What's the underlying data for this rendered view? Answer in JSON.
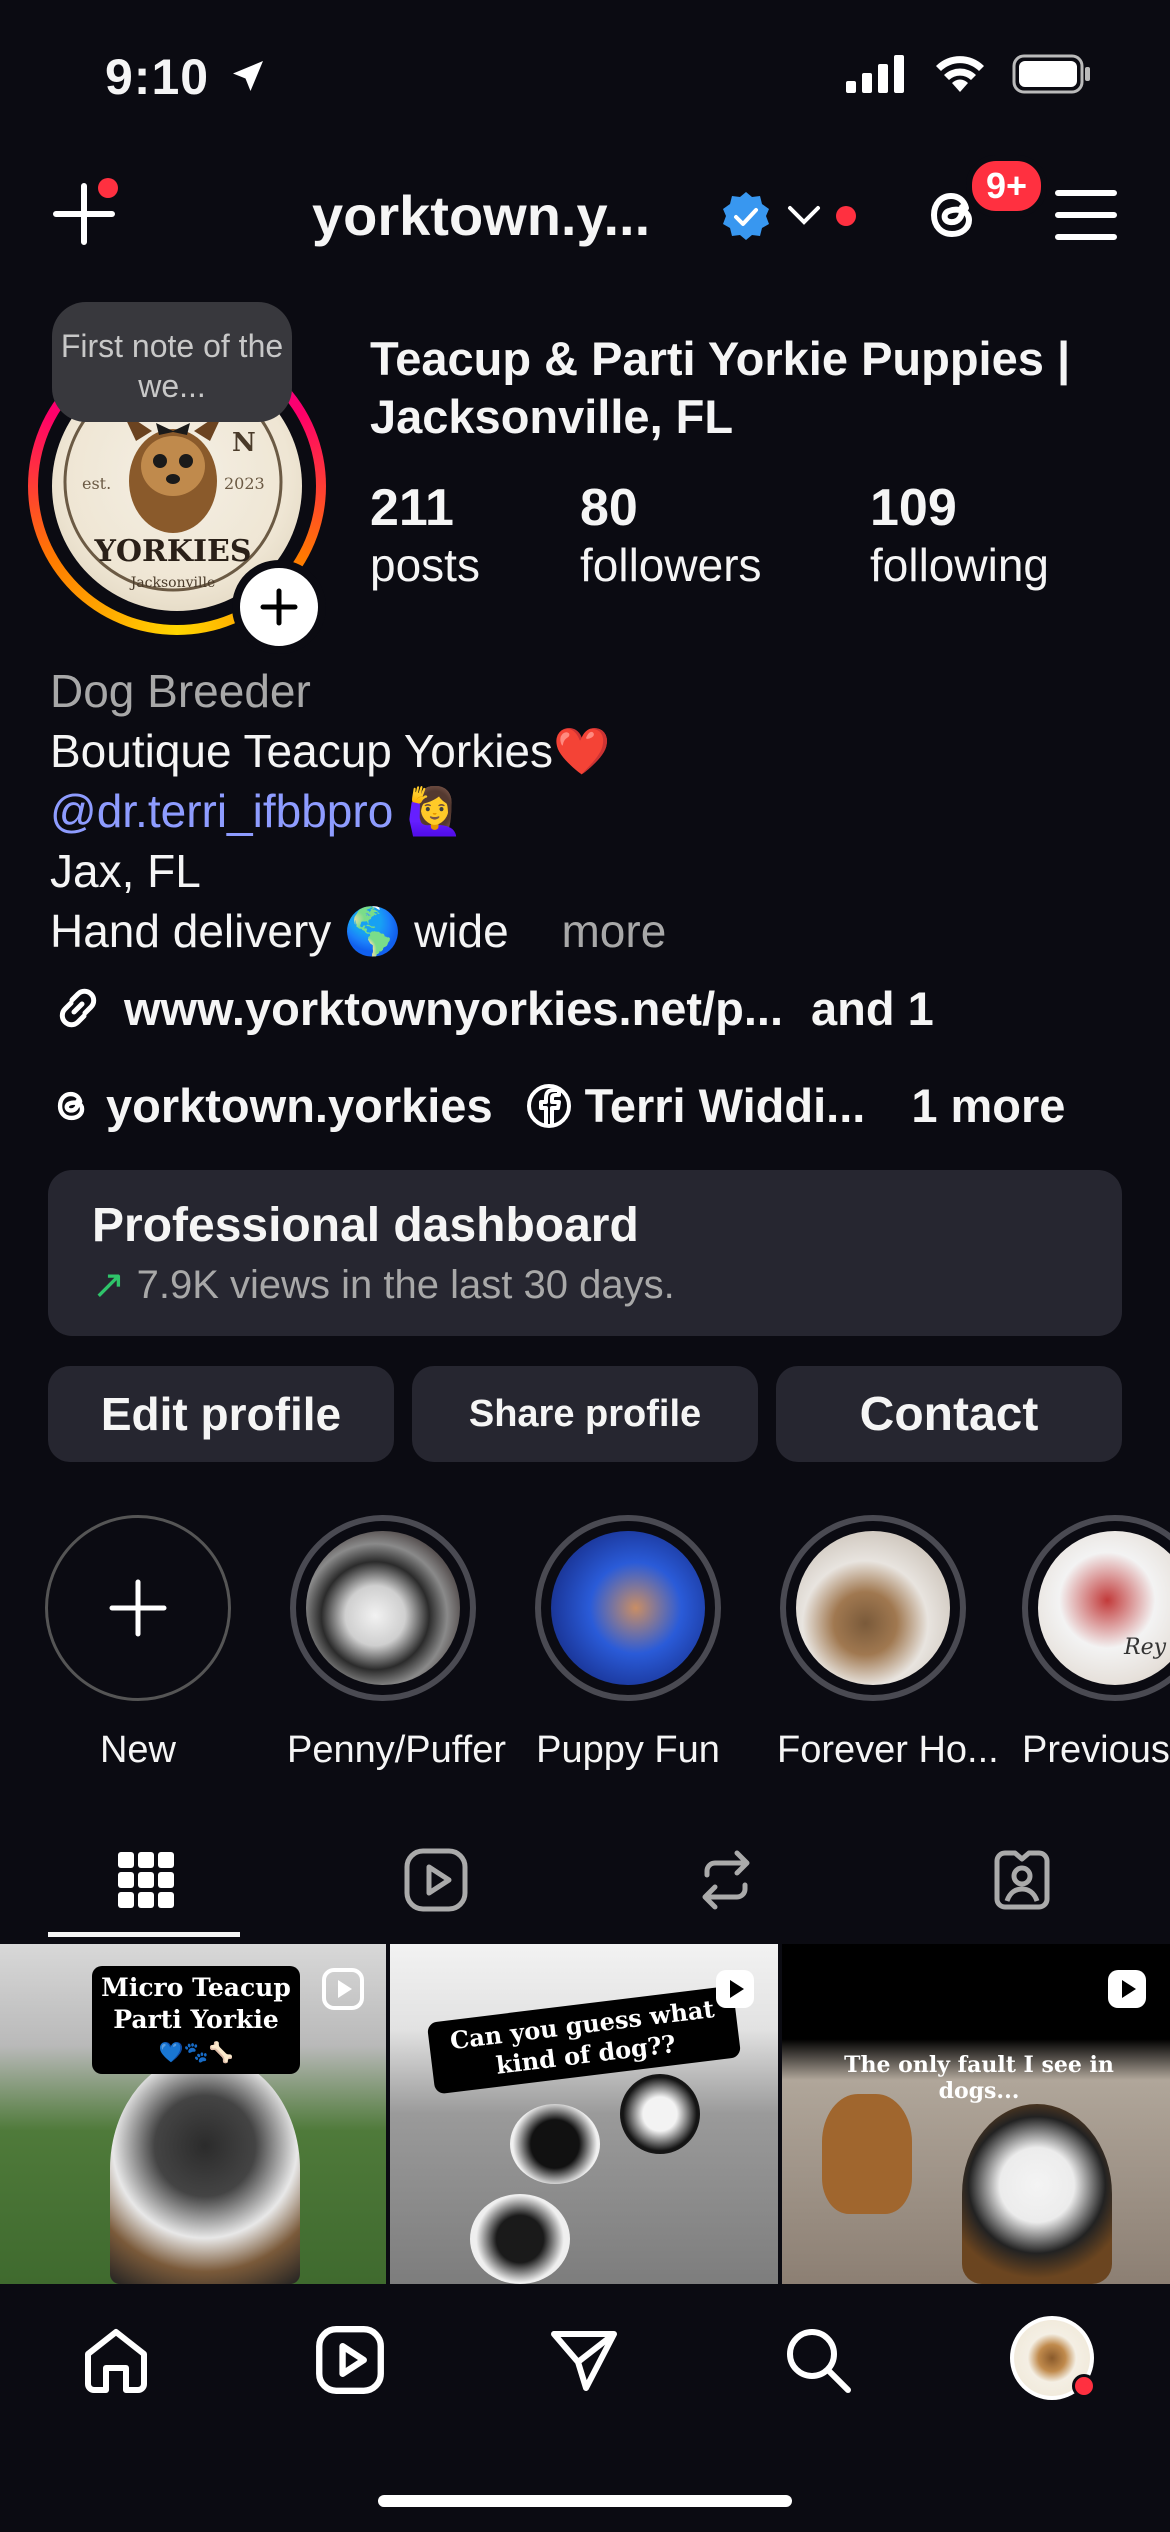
{
  "status_bar": {
    "time": "9:10"
  },
  "header": {
    "username": "yorktown.y...",
    "threads_badge": "9+"
  },
  "profile": {
    "note": "First note of the we...",
    "display_name": "Teacup & Parti Yorkie Puppies | Jacksonville, FL",
    "stats": [
      {
        "value": "211",
        "label": "posts"
      },
      {
        "value": "80",
        "label": "followers"
      },
      {
        "value": "109",
        "label": "following"
      }
    ],
    "avatar_text": {
      "est": "est.",
      "year": "2023",
      "brand": "YORKIES",
      "city": "Jacksonville",
      "letter": "N"
    }
  },
  "bio": {
    "category": "Dog Breeder",
    "line1": "Boutique Teacup Yorkies❤️",
    "mention": "@dr.terri_ifbbpro",
    "mention_emoji": "🙋‍♀️",
    "line3": "Jax, FL",
    "line4": "Hand delivery 🌎 wide",
    "more": "more"
  },
  "links": {
    "url": "www.yorktownyorkies.net/p...",
    "and_more": "and 1"
  },
  "social": {
    "threads": "yorktown.yorkies",
    "facebook": "Terri Widdi...",
    "more": "1 more"
  },
  "dashboard": {
    "title": "Professional dashboard",
    "arrow": "↗",
    "subtitle": "7.9K views in the last 30 days."
  },
  "actions": {
    "edit": "Edit profile",
    "share": "Share profile",
    "contact": "Contact"
  },
  "highlights": [
    {
      "label": "New"
    },
    {
      "label": "Penny/Puffer"
    },
    {
      "label": "Puppy Fun"
    },
    {
      "label": "Forever Ho..."
    },
    {
      "label": "Previous"
    }
  ],
  "highlight_extra": {
    "rei": "Rey"
  },
  "posts": [
    {
      "caption": "Micro Teacup Parti Yorkie",
      "emoji": "💙🐾🦴"
    },
    {
      "caption": "Can you guess what kind of dog??"
    },
    {
      "caption": "The only fault I see in dogs..."
    }
  ],
  "colors": {
    "accent_link": "#8e9cff",
    "badge_red": "#ff3040",
    "verified_blue": "#3897f0",
    "trend_green": "#2fc46a"
  },
  "icons": [
    "plus-icon",
    "verified-badge-icon",
    "chevron-down-icon",
    "threads-icon",
    "menu-icon",
    "link-icon",
    "facebook-icon",
    "grid-icon",
    "reels-icon",
    "reposts-icon",
    "tagged-icon",
    "home-icon",
    "search-icon",
    "send-icon"
  ]
}
